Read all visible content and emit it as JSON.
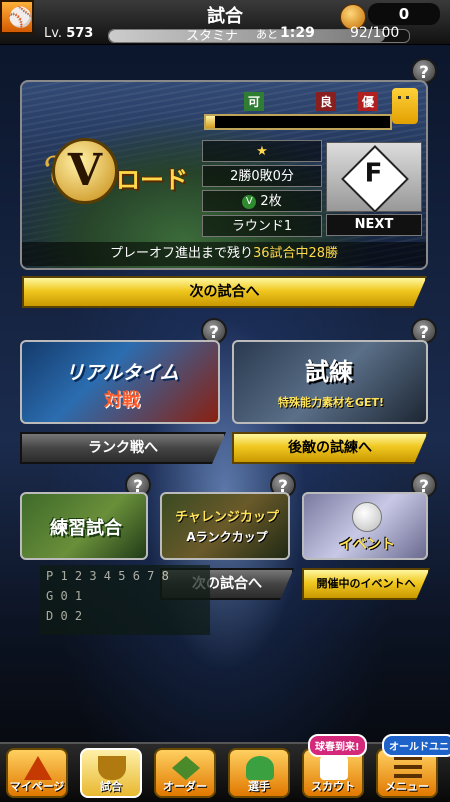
{
  "header": {
    "title": "試合",
    "coins": "0",
    "level_prefix": "Lv.",
    "level": "573",
    "stamina_label": "スタミナ",
    "stamina_ato": "あと",
    "stamina_time": "1:29",
    "stamina_value": "92/100",
    "stamina_fraction": 0.92,
    "logo_icon": "team-logo-icon"
  },
  "vroad": {
    "badge_letter": "V",
    "badge_text": "ロード",
    "flags": [
      "可",
      "良",
      "優"
    ],
    "flag_colors": [
      "#2e7d32",
      "#8a1f1f",
      "#b12020"
    ],
    "progress_fraction": 0.05,
    "rank_star": "★",
    "record": "2勝0敗0分",
    "ticket_icon": "V",
    "tickets": "2枚",
    "round": "ラウンド1",
    "opponent_letter": "F",
    "next_label": "NEXT",
    "playoff_prefix": "プレーオフ進出まで残り",
    "playoff_highlight": "36試合中28勝",
    "next_game_button": "次の試合へ"
  },
  "modes": {
    "realtime": {
      "title": "リアルタイム",
      "subtitle": "対戦",
      "button": "ランク戦へ"
    },
    "trial": {
      "title": "試練",
      "subtitle": "特殊能力素材をGET!",
      "button": "後敵の試練へ"
    },
    "practice": {
      "title": "練習試合"
    },
    "challenge": {
      "title": "チャレンジカップ",
      "subtitle": "Aランクカップ",
      "button": "次の試合へ"
    },
    "event": {
      "title": "イベント",
      "button": "開催中のイベントへ"
    }
  },
  "help_label": "?",
  "scoreboard": {
    "row1": "P 1 2 3 4 5 6 7 8",
    "row2": "G 0 1",
    "row3": "D 0 2"
  },
  "tabs": [
    {
      "label": "マイページ",
      "icon": "mypage-icon"
    },
    {
      "label": "試合",
      "icon": "game-trophy-icon"
    },
    {
      "label": "オーダー",
      "icon": "order-field-icon"
    },
    {
      "label": "選手",
      "icon": "player-icon"
    },
    {
      "label": "スカウト",
      "icon": "scout-icon"
    },
    {
      "label": "メニュー",
      "icon": "menu-icon"
    }
  ],
  "badges": {
    "scout": "球春到来!",
    "menu": "オールドユニ"
  },
  "colors": {
    "accent_yellow": "#f0c820",
    "highlight": "#ffd94a",
    "header_bg": "#1a1a1a"
  }
}
